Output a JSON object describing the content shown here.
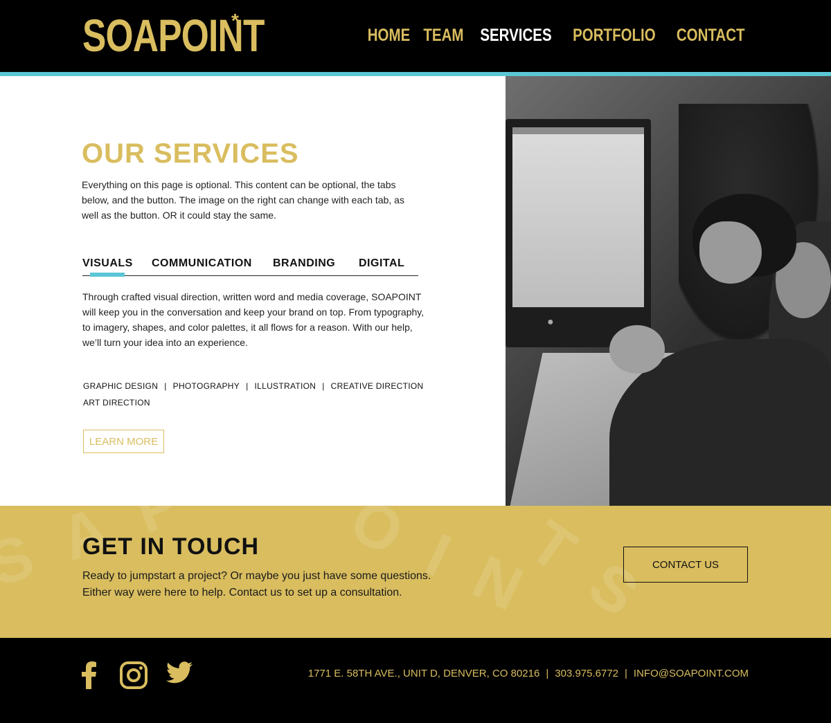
{
  "header": {
    "logo": "SOAPOINT",
    "logo_mark": "*",
    "nav": [
      "HOME",
      "TEAM",
      "SERVICES",
      "PORTFOLIO",
      "CONTACT"
    ],
    "active_nav": "SERVICES"
  },
  "services": {
    "title": "OUR SERVICES",
    "intro": "Everything on this page is optional. This content can be optional, the tabs below, and the button. The image on the right can change with each tab, as well as the button. OR it could stay the same.",
    "tabs": [
      "VISUALS",
      "COMMUNICATION",
      "BRANDING",
      "DIGITAL"
    ],
    "active_tab": "VISUALS",
    "tab_body": "Through crafted visual direction, written word and media coverage, SOAPOINT will keep you in the conversation and keep your brand on top. From typography, to imagery, shapes, and color palettes, it all flows for a reason. With our help, we’ll turn your idea into an experience.",
    "tags": [
      "GRAPHIC DESIGN",
      "PHOTOGRAPHY",
      "ILLUSTRATION",
      "CREATIVE DIRECTION",
      "ART DIRECTION"
    ],
    "tag_separator": "|",
    "button": "LEARN MORE"
  },
  "cta": {
    "title": "GET IN TOUCH",
    "text_line1": "Ready to jumpstart a project? Or maybe you just have some questions.",
    "text_line2": "Either way were here to help. Contact us to set up a consultation.",
    "button": "CONTACT US"
  },
  "footer": {
    "social_icons": [
      "facebook-icon",
      "instagram-icon",
      "twitter-icon"
    ],
    "address": "1771 E. 58TH AVE., UNIT D, DENVER, CO 80216",
    "phone": "303.975.6772",
    "email": "INFO@SOAPOINT.COM",
    "separator": "|"
  },
  "colors": {
    "gold": "#d9bd5f",
    "teal": "#5bc6d6",
    "black": "#000000"
  }
}
